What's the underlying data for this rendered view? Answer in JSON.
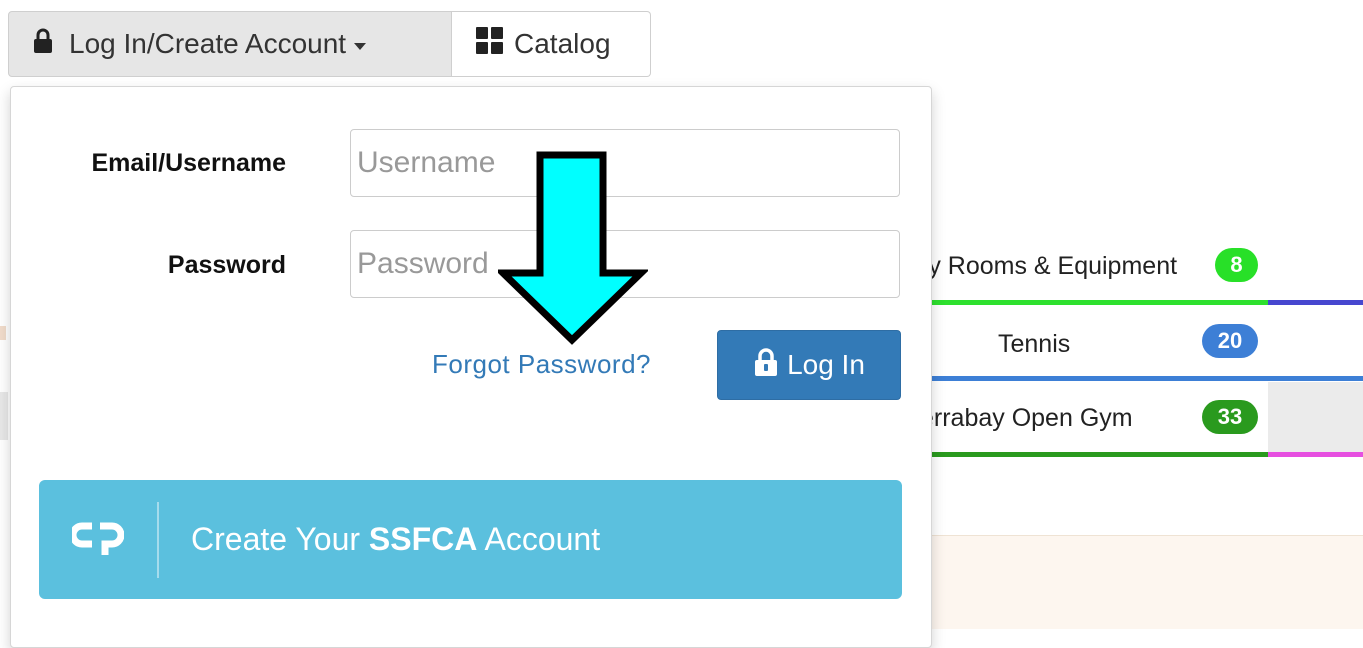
{
  "toolbar": {
    "login_label": "Log In/Create Account",
    "catalog_label": "Catalog"
  },
  "login_form": {
    "email_label": "Email/Username",
    "email_placeholder": "Username",
    "password_label": "Password",
    "password_placeholder": "Password",
    "forgot_link": "Forgot Password?",
    "login_button": "Log In",
    "create_prefix": "Create Your ",
    "create_brand": "SSFCA",
    "create_suffix": " Account"
  },
  "categories": [
    {
      "name": "ry Rooms & Equipment",
      "count": "8",
      "badge_color": "#28e028"
    },
    {
      "name": "Tennis",
      "count": "20",
      "badge_color": "#3d7fd6"
    },
    {
      "name": "errabay Open Gym",
      "count": "33",
      "badge_color": "#2a9a1e"
    }
  ],
  "colors": {
    "primary": "#337ab7",
    "info": "#5bc0de",
    "arrow_fill": "#00ffff",
    "bar_green": "#2ee02e",
    "bar_indigo": "#4747cf",
    "bar_blue": "#3d7fd6",
    "bar_magenta": "#e64fe0"
  },
  "icons": {
    "lock": "lock-icon",
    "grid": "grid-icon",
    "brand": "brand-logo-icon",
    "arrow": "down-arrow-pointer-icon"
  }
}
